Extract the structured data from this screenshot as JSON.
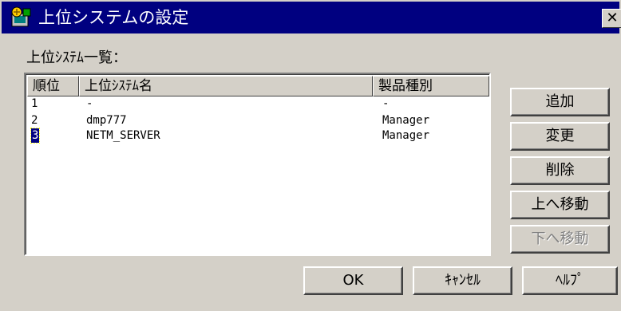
{
  "window": {
    "title": "上位システムの設定",
    "close_glyph": "✕"
  },
  "list": {
    "label": "上位ｼｽﾃﾑ一覧：",
    "columns": [
      "順位",
      "上位ｼｽﾃﾑ名",
      "製品種別"
    ],
    "rows": [
      {
        "rank": "1",
        "name": "-",
        "type": "-"
      },
      {
        "rank": "2",
        "name": "dmp777",
        "type": "Manager"
      },
      {
        "rank": "3",
        "name": "NETM_SERVER",
        "type": "Manager"
      }
    ],
    "selected_row": 3
  },
  "side_buttons": {
    "add": "追加",
    "change": "変更",
    "delete": "削除",
    "move_up": "上へ移動",
    "move_down": "下へ移動"
  },
  "bottom_buttons": {
    "ok": "OK",
    "cancel": "ｷｬﾝｾﾙ",
    "help": "ﾍﾙﾌﾟ"
  },
  "colors": {
    "titlebar": "#000080",
    "face": "#d4d0c8",
    "selection": "#000080"
  },
  "icons": {
    "app": "settings-app-icon",
    "close": "close-icon"
  }
}
